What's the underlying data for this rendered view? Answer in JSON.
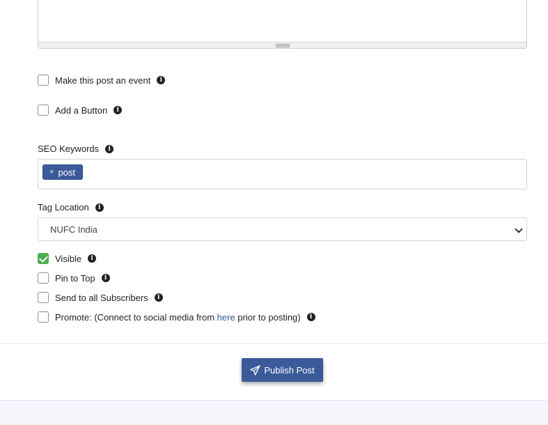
{
  "options": {
    "event_label": "Make this post an event",
    "button_label": "Add a Button"
  },
  "seo": {
    "label": "SEO Keywords",
    "tags": [
      {
        "remove_symbol": "×",
        "text": "post"
      }
    ]
  },
  "tag_location": {
    "label": "Tag Location",
    "selected": "NUFC India"
  },
  "checks": {
    "visible": {
      "label": "Visible",
      "checked": true
    },
    "pin": {
      "label": "Pin to Top",
      "checked": false
    },
    "subscribers": {
      "label": "Send to all Subscribers",
      "checked": false
    },
    "promote": {
      "prefix": "Promote: (Connect to social media from ",
      "link": "here",
      "suffix": " prior to posting)",
      "checked": false
    }
  },
  "info_symbol": "i",
  "publish": {
    "label": "Publish Post",
    "icon": "paper-plane-icon"
  },
  "colors": {
    "accent": "#3b5a99",
    "check_green": "#4cae4f",
    "link": "#2f5597"
  }
}
